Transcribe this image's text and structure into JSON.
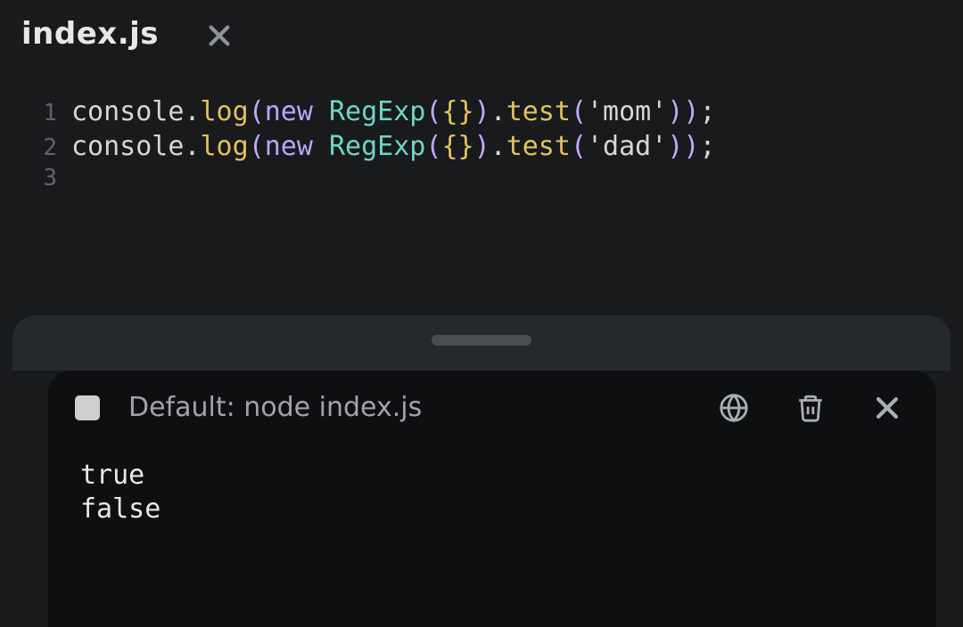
{
  "tab": {
    "filename": "index.js"
  },
  "editor": {
    "lines": [
      {
        "n": "1",
        "tokens": [
          {
            "t": "console",
            "c": "tok-obj"
          },
          {
            "t": ".",
            "c": "tok-punct"
          },
          {
            "t": "log",
            "c": "tok-func"
          },
          {
            "t": "(",
            "c": "tok-paren"
          },
          {
            "t": "new ",
            "c": "tok-kw"
          },
          {
            "t": "RegExp",
            "c": "tok-type"
          },
          {
            "t": "(",
            "c": "tok-paren"
          },
          {
            "t": "{}",
            "c": "tok-brace"
          },
          {
            "t": ")",
            "c": "tok-paren"
          },
          {
            "t": ".",
            "c": "tok-punct"
          },
          {
            "t": "test",
            "c": "tok-func"
          },
          {
            "t": "(",
            "c": "tok-paren"
          },
          {
            "t": "'mom'",
            "c": "tok-str"
          },
          {
            "t": ")",
            "c": "tok-paren"
          },
          {
            "t": ")",
            "c": "tok-paren"
          },
          {
            "t": ";",
            "c": "tok-punct"
          }
        ]
      },
      {
        "n": "2",
        "tokens": [
          {
            "t": "console",
            "c": "tok-obj"
          },
          {
            "t": ".",
            "c": "tok-punct"
          },
          {
            "t": "log",
            "c": "tok-func"
          },
          {
            "t": "(",
            "c": "tok-paren"
          },
          {
            "t": "new ",
            "c": "tok-kw"
          },
          {
            "t": "RegExp",
            "c": "tok-type"
          },
          {
            "t": "(",
            "c": "tok-paren"
          },
          {
            "t": "{}",
            "c": "tok-brace"
          },
          {
            "t": ")",
            "c": "tok-paren"
          },
          {
            "t": ".",
            "c": "tok-punct"
          },
          {
            "t": "test",
            "c": "tok-func"
          },
          {
            "t": "(",
            "c": "tok-paren"
          },
          {
            "t": "'dad'",
            "c": "tok-str"
          },
          {
            "t": ")",
            "c": "tok-paren"
          },
          {
            "t": ")",
            "c": "tok-paren"
          },
          {
            "t": ";",
            "c": "tok-punct"
          }
        ]
      },
      {
        "n": "3",
        "tokens": []
      }
    ]
  },
  "terminal": {
    "title": "Default: node index.js",
    "output": [
      "true",
      "false"
    ]
  }
}
